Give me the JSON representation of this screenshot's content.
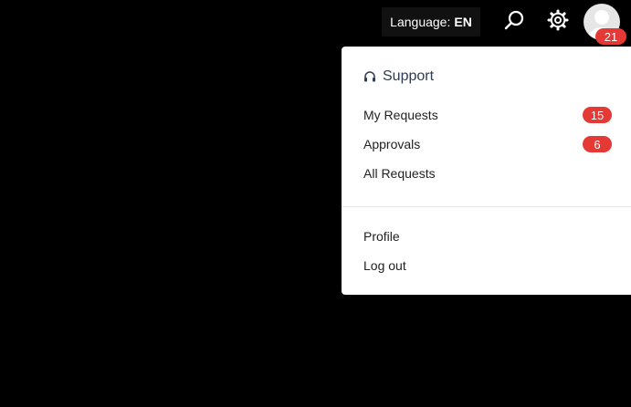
{
  "header": {
    "language_label": "Language:",
    "language_code": "EN",
    "search_icon": "search-icon",
    "settings_icon": "gear-icon",
    "avatar_icon": "user-avatar-icon",
    "notification_count": "21"
  },
  "dropdown": {
    "section_title": "Support",
    "section_icon": "headset-icon",
    "items": [
      {
        "label": "My Requests",
        "badge": "15"
      },
      {
        "label": "Approvals",
        "badge": "6"
      },
      {
        "label": "All Requests"
      }
    ],
    "account_items": [
      {
        "label": "Profile"
      },
      {
        "label": "Log out"
      }
    ]
  },
  "colors": {
    "background": "#000000",
    "badge": "#e53935",
    "panel": "#ffffff",
    "section_title": "#2d3b55"
  }
}
